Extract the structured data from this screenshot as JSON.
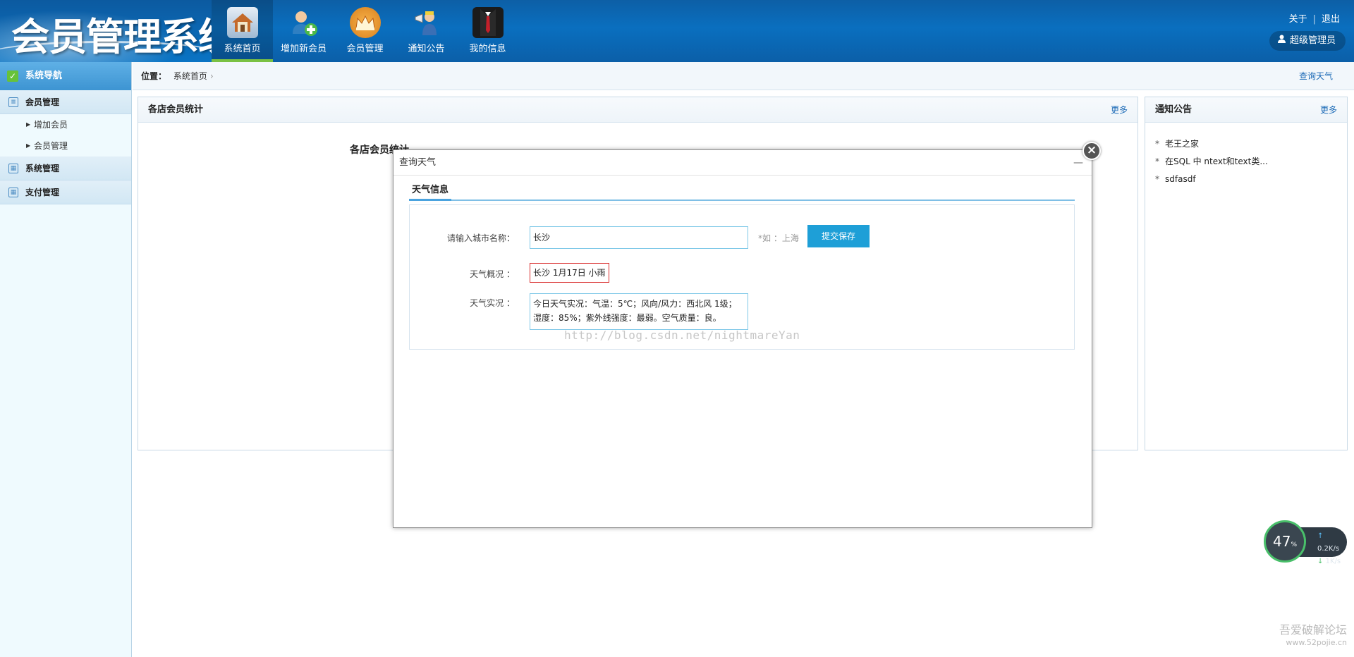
{
  "header": {
    "logo_text": "会员管理系统",
    "nav": [
      {
        "label": "系统首页",
        "icon": "house-icon"
      },
      {
        "label": "增加新会员",
        "icon": "add-user-icon"
      },
      {
        "label": "会员管理",
        "icon": "crown-icon"
      },
      {
        "label": "通知公告",
        "icon": "megaphone-icon"
      },
      {
        "label": "我的信息",
        "icon": "suit-icon"
      }
    ],
    "about": "关于",
    "logout": "退出",
    "admin": "超级管理员"
  },
  "sidebar": {
    "title": "系统导航",
    "groups": [
      {
        "label": "会员管理",
        "items": [
          "增加会员",
          "会员管理"
        ]
      },
      {
        "label": "系统管理"
      },
      {
        "label": "支付管理"
      }
    ]
  },
  "breadcrumb": {
    "prefix": "位置：",
    "current": "系统首页",
    "weather_link": "查询天气"
  },
  "stats_panel": {
    "title": "各店会员统计",
    "more": "更多",
    "chart_title": "各店会员统计"
  },
  "notice_panel": {
    "title": "通知公告",
    "more": "更多",
    "items": [
      "老王之家",
      "在SQL 中 ntext和text类...",
      "sdfasdf"
    ]
  },
  "modal": {
    "title": "查询天气",
    "tab": "天气信息",
    "city_label": "请输入城市名称：",
    "city_value": "长沙",
    "hint": "*如 ：上海",
    "submit": "提交保存",
    "summary_label": "天气概况 ：",
    "summary_value": "长沙 1月17日 小雨",
    "detail_label": "天气实况 ：",
    "detail_value": "今日天气实况：气温：5℃；风向/风力：西北风 1级；湿度：85%；紫外线强度：最弱。空气质量：良。",
    "watermark": "http://blog.csdn.net/nightmareYan"
  },
  "speed_widget": {
    "percent": "47",
    "percent_unit": "%",
    "up": "0.2K/s",
    "down": "1K/s"
  },
  "footer_mark": {
    "line1": "吾爱破解论坛",
    "line2": "www.52pojie.cn"
  }
}
